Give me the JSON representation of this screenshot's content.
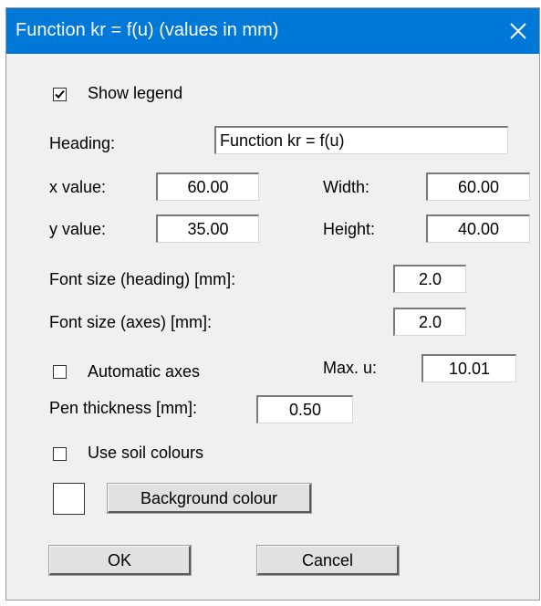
{
  "window": {
    "title": "Function kr = f(u) (values in mm)"
  },
  "show_legend": {
    "label": "Show legend",
    "checked": true
  },
  "heading": {
    "label": "Heading:",
    "value": "Function kr = f(u)"
  },
  "x_value": {
    "label": "x value:",
    "value": "60.00"
  },
  "y_value": {
    "label": "y value:",
    "value": "35.00"
  },
  "width": {
    "label": "Width:",
    "value": "60.00"
  },
  "height": {
    "label": "Height:",
    "value": "40.00"
  },
  "font_size_heading": {
    "label": "Font size (heading) [mm]:",
    "value": "2.0"
  },
  "font_size_axes": {
    "label": "Font size (axes) [mm]:",
    "value": "2.0"
  },
  "automatic_axes": {
    "label": "Automatic axes",
    "checked": false
  },
  "max_u": {
    "label": "Max. u:",
    "value": "10.01"
  },
  "pen_thickness": {
    "label": "Pen thickness [mm]:",
    "value": "0.50"
  },
  "use_soil_colours": {
    "label": "Use soil colours",
    "checked": false
  },
  "background": {
    "swatch_color": "#ffffff",
    "button_label": "Background colour"
  },
  "buttons": {
    "ok": "OK",
    "cancel": "Cancel"
  },
  "colors": {
    "titlebar": "#0078d7",
    "dialog_bg": "#f0f0f0",
    "title_text": "#ffffff"
  }
}
